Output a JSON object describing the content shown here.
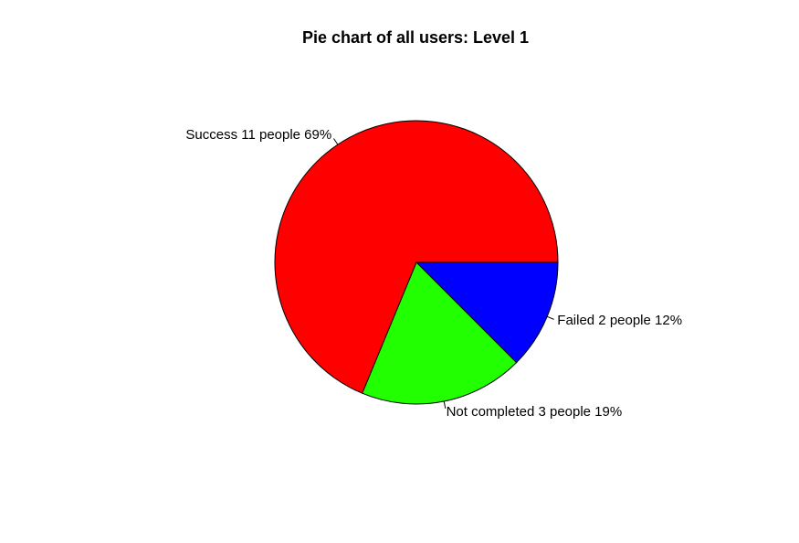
{
  "chart_data": {
    "type": "pie",
    "title": "Pie chart of all users: Level 1",
    "slices": [
      {
        "category": "Failed",
        "count": 2,
        "percent": 12,
        "label": "Failed 2 people 12%",
        "color": "#0000FF"
      },
      {
        "category": "Not completed",
        "count": 3,
        "percent": 19,
        "label": "Not completed 3 people 19%",
        "color": "#22FF00"
      },
      {
        "category": "Success",
        "count": 11,
        "percent": 69,
        "label": "Success 11 people 69%",
        "color": "#FF0000"
      }
    ],
    "start_angle": "3 o'clock",
    "direction": "clockwise",
    "legend": "none"
  }
}
